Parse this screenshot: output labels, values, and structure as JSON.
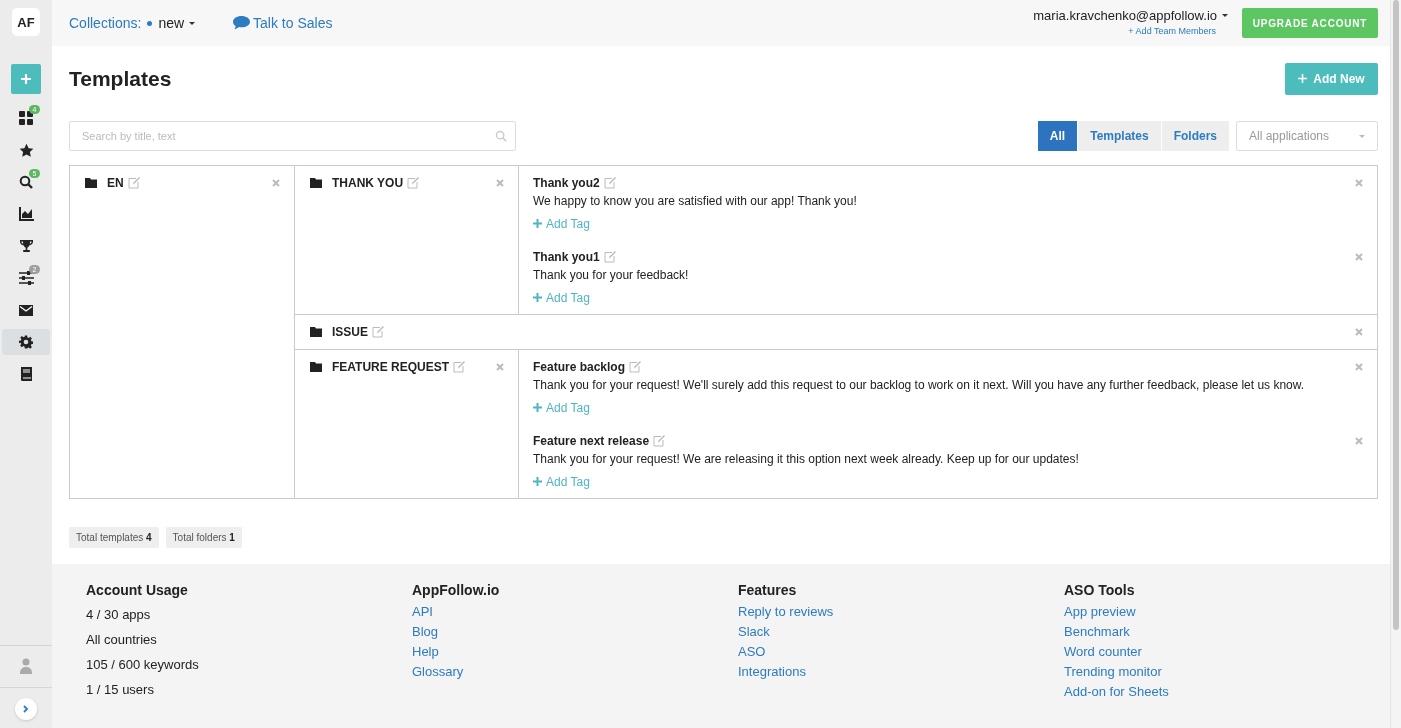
{
  "logo": "AF",
  "sidebar": {
    "items": [
      {
        "kind": "add",
        "selected": false
      },
      {
        "kind": "grid",
        "badge": "4",
        "color": "#5cb85c",
        "selected": false
      },
      {
        "kind": "star",
        "selected": false
      },
      {
        "kind": "search",
        "badge": "5",
        "color": "#5cb85c",
        "selected": false
      },
      {
        "kind": "chart",
        "selected": false
      },
      {
        "kind": "trophy",
        "selected": false
      },
      {
        "kind": "sliders",
        "badge": "2",
        "color": "#9e9e9e",
        "selected": false
      },
      {
        "kind": "mail",
        "selected": false
      },
      {
        "kind": "gear",
        "selected": true
      },
      {
        "kind": "book",
        "selected": false
      }
    ]
  },
  "topbar": {
    "collections_label": "Collections:",
    "collection": "new",
    "talk_to_sales": "Talk to Sales",
    "user_email": "maria.kravchenko@appfollow.io",
    "add_team_members": "+ Add Team Members",
    "upgrade_button": "UPGRADE ACCOUNT"
  },
  "page": {
    "title": "Templates",
    "add_new": "Add New"
  },
  "toolbar": {
    "search": {
      "placeholder": "Search by title, text"
    },
    "filters": [
      {
        "label": "All",
        "selected": true
      },
      {
        "label": "Templates",
        "selected": false
      },
      {
        "label": "Folders",
        "selected": false
      }
    ],
    "app_select": "All applications"
  },
  "folders": [
    {
      "name": "EN",
      "subfolders": [
        {
          "name": "THANK YOU",
          "templates": [
            {
              "title": "Thank you2",
              "text": "We happy to know you are satisfied with our app! Thank you!",
              "add_tag": "Add Tag"
            },
            {
              "title": "Thank you1",
              "text": "Thank you for your feedback!",
              "add_tag": "Add Tag"
            }
          ]
        },
        {
          "name": "ISSUE"
        },
        {
          "name": "FEATURE REQUEST",
          "templates": [
            {
              "title": "Feature backlog",
              "text": "Thank you for your request! We'll surely add this request to our backlog to work on it next. Will you have any further feedback, please let us know.",
              "add_tag": "Add Tag"
            },
            {
              "title": "Feature next release",
              "text": "Thank you for your request! We are releasing it this option next week already. Keep up for our updates!",
              "add_tag": "Add Tag"
            }
          ]
        }
      ]
    }
  ],
  "totals": [
    {
      "label": "Total templates",
      "value": "4"
    },
    {
      "label": "Total folders",
      "value": "1"
    }
  ],
  "footer": {
    "columns": [
      {
        "kind": "text",
        "title": "Account Usage",
        "items": [
          "4 / 30 apps",
          "All countries",
          "105 / 600 keywords",
          "1 / 15 users"
        ]
      },
      {
        "kind": "links",
        "title": "AppFollow.io",
        "items": [
          "API",
          "Blog",
          "Help",
          "Glossary"
        ]
      },
      {
        "kind": "links",
        "title": "Features",
        "items": [
          "Reply to reviews",
          "Slack",
          "ASO",
          "Integrations"
        ]
      },
      {
        "kind": "links",
        "title": "ASO Tools",
        "items": [
          "App preview",
          "Benchmark",
          "Word counter",
          "Trending monitor",
          "Add-on for Sheets"
        ]
      }
    ]
  }
}
